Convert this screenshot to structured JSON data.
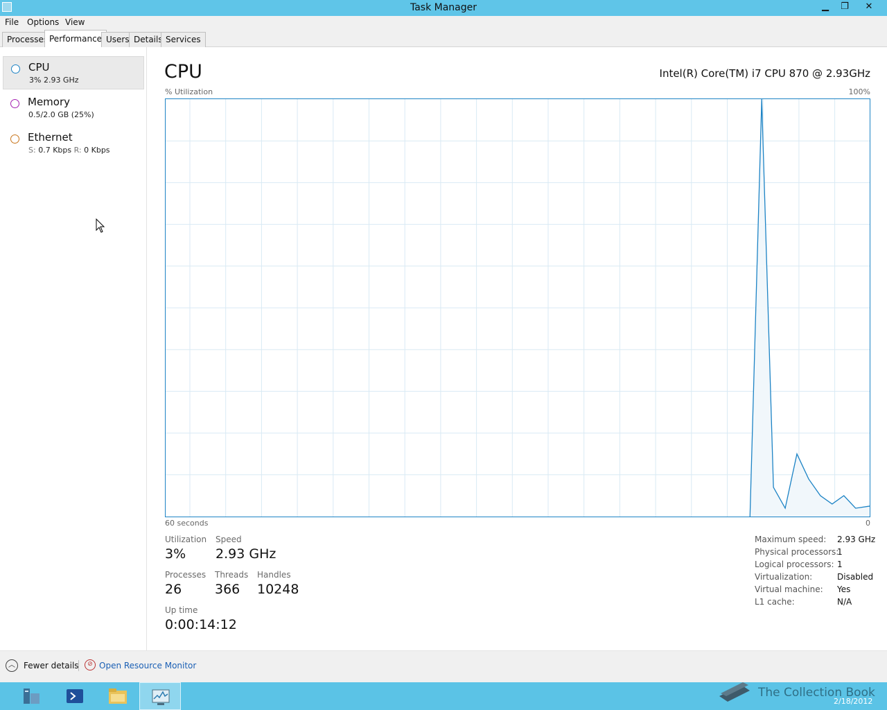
{
  "window": {
    "title": "Task Manager"
  },
  "menu": [
    "File",
    "Options",
    "View"
  ],
  "tabs": [
    "Processes",
    "Performance",
    "Users",
    "Details",
    "Services"
  ],
  "active_tab": "Performance",
  "sidebar": {
    "items": [
      {
        "name": "CPU",
        "sub": "3%  2.93 GHz",
        "ring_color": "#1c83c5",
        "selected": true
      },
      {
        "name": "Memory",
        "sub": "0.5/2.0 GB (25%)",
        "ring_color": "#a31fb0",
        "selected": false
      },
      {
        "name": "Ethernet",
        "sub_s_label": "S:",
        "sub_s_value": "0.7 Kbps",
        "sub_r_label": "R:",
        "sub_r_value": "0 Kbps",
        "ring_color": "#c8741a",
        "selected": false
      }
    ]
  },
  "main": {
    "title": "CPU",
    "model": "Intel(R) Core(TM) i7 CPU 870 @ 2.93GHz",
    "graph": {
      "y_label": "% Utilization",
      "y_max_label": "100%",
      "x_left_label": "60 seconds",
      "x_right_label": "0"
    },
    "stats": {
      "utilization_label": "Utilization",
      "utilization": "3%",
      "speed_label": "Speed",
      "speed": "2.93 GHz",
      "processes_label": "Processes",
      "processes": "26",
      "threads_label": "Threads",
      "threads": "366",
      "handles_label": "Handles",
      "handles": "10248",
      "uptime_label": "Up time",
      "uptime": "0:00:14:12"
    },
    "specs": [
      {
        "k": "Maximum speed:",
        "v": "2.93 GHz"
      },
      {
        "k": "Physical processors:",
        "v": "1"
      },
      {
        "k": "Logical processors:",
        "v": "1"
      },
      {
        "k": "Virtualization:",
        "v": "Disabled"
      },
      {
        "k": "Virtual machine:",
        "v": "Yes"
      },
      {
        "k": "L1 cache:",
        "v": "N/A"
      }
    ]
  },
  "chart_data": {
    "type": "area",
    "ylim": [
      0,
      100
    ],
    "xlim": [
      60,
      0
    ],
    "series": [
      {
        "x": [
          60,
          10.2,
          9.2,
          8.2,
          7.2,
          6.2,
          5.2,
          4.2,
          3.2,
          2.2,
          1.2,
          0
        ],
        "values": [
          0,
          0,
          100,
          7,
          2,
          15,
          9,
          5,
          3,
          5,
          2,
          2.5
        ]
      }
    ]
  },
  "footer": {
    "fewer_details": "Fewer details",
    "open_resource_monitor": "Open Resource Monitor"
  },
  "taskbar": {
    "watermark": "The Collection Book",
    "date": "2/18/2012"
  }
}
